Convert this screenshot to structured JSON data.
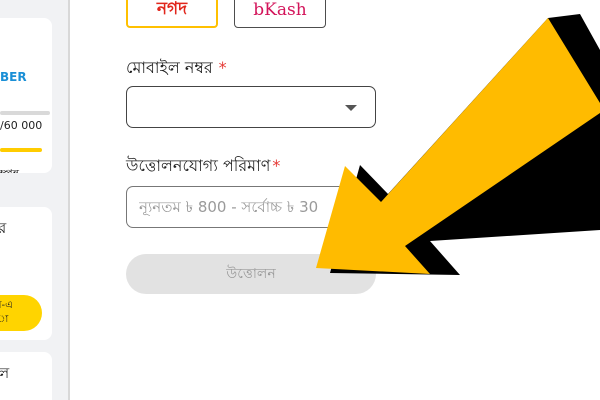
{
  "sidebar": {
    "member_label": "BER",
    "member_progress_value": "/60 000",
    "member_status": "ম্পন্ন",
    "card2_title": "র",
    "card2_button": "র-এ\nা",
    "card3_title": "ল"
  },
  "payment_methods": {
    "nagad": "নগদ",
    "bkash": "bKash"
  },
  "form": {
    "mobile_label": "মোবাইল নম্বর",
    "required_mark": "*",
    "mobile_value": "",
    "amount_label": "উত্তোলনযোগ্য পরিমাণ",
    "amount_placeholder": "ন্যূনতম ৳ 800 - সর্বোচ্চ ৳ 30",
    "withdraw_button": "উত্তোলন"
  },
  "colors": {
    "accent": "#ffc000",
    "arrow": "#ffbb00",
    "arrow_shadow": "#000000",
    "required": "#e53935"
  }
}
